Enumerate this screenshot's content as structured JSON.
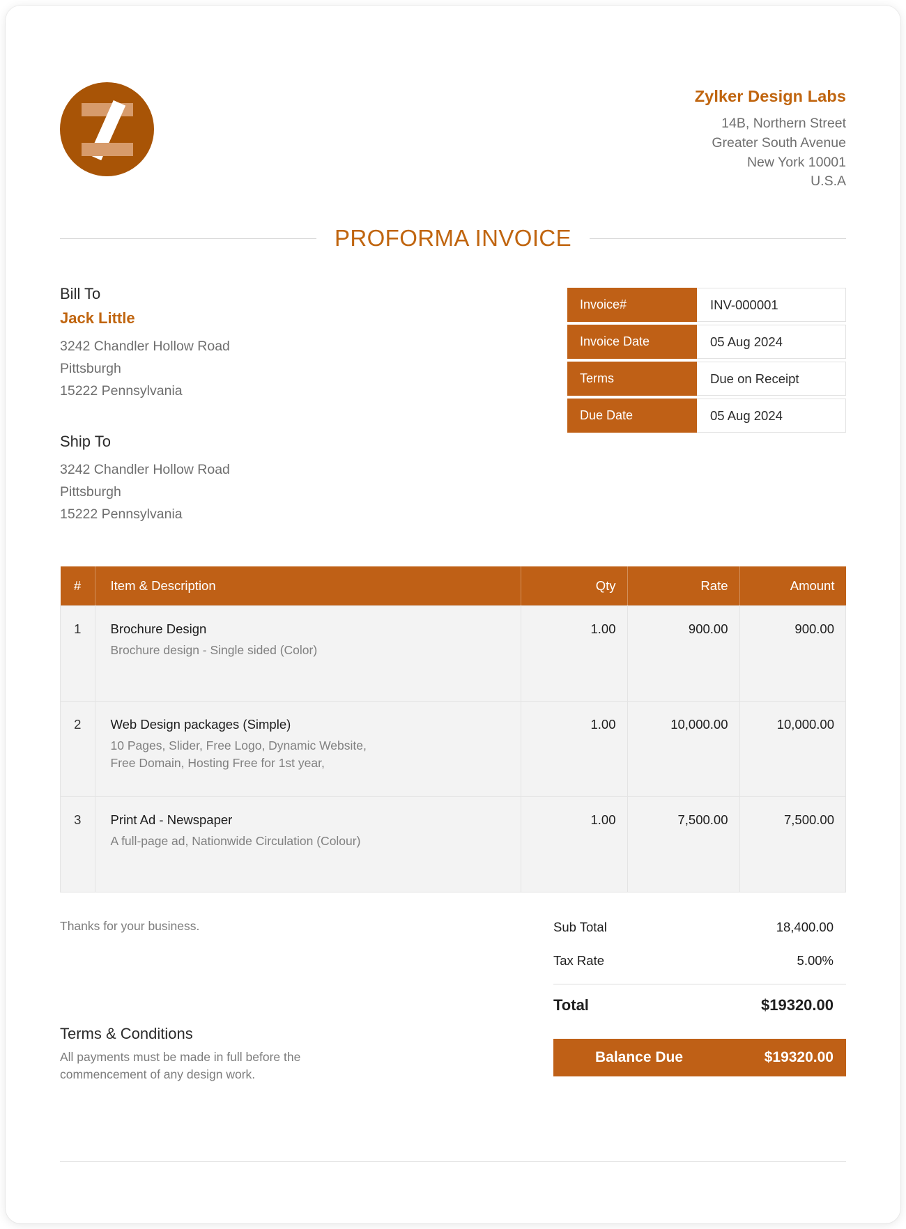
{
  "company": {
    "logo_letter": "Z",
    "name": "Zylker Design Labs",
    "address": [
      "14B, Northern Street",
      "Greater South Avenue",
      "New York 10001",
      "U.S.A"
    ]
  },
  "document": {
    "title": "PROFORMA INVOICE"
  },
  "bill_to": {
    "label": "Bill To",
    "name": "Jack Little",
    "address": [
      "3242 Chandler Hollow Road",
      "Pittsburgh",
      "15222 Pennsylvania"
    ]
  },
  "ship_to": {
    "label": "Ship To",
    "address": [
      "3242 Chandler Hollow Road",
      "Pittsburgh",
      "15222 Pennsylvania"
    ]
  },
  "details": [
    {
      "label": "Invoice#",
      "value": "INV-000001"
    },
    {
      "label": "Invoice Date",
      "value": "05 Aug 2024"
    },
    {
      "label": "Terms",
      "value": "Due on Receipt"
    },
    {
      "label": "Due Date",
      "value": "05 Aug 2024"
    }
  ],
  "items_table": {
    "columns": [
      "#",
      "Item & Description",
      "Qty",
      "Rate",
      "Amount"
    ],
    "rows": [
      {
        "no": "1",
        "name": "Brochure Design",
        "desc": [
          "Brochure design - Single sided (Color)"
        ],
        "qty": "1.00",
        "rate": "900.00",
        "amount": "900.00"
      },
      {
        "no": "2",
        "name": "Web Design packages (Simple)",
        "desc": [
          "10 Pages, Slider, Free Logo, Dynamic Website,",
          "Free Domain, Hosting Free for 1st year,"
        ],
        "qty": "1.00",
        "rate": "10,000.00",
        "amount": "10,000.00"
      },
      {
        "no": "3",
        "name": "Print Ad - Newspaper",
        "desc": [
          "A full-page ad, Nationwide Circulation (Colour)"
        ],
        "qty": "1.00",
        "rate": "7,500.00",
        "amount": "7,500.00"
      }
    ]
  },
  "thanks_note": "Thanks for your business.",
  "totals": {
    "sub_total_label": "Sub Total",
    "sub_total_value": "18,400.00",
    "tax_rate_label": "Tax Rate",
    "tax_rate_value": "5.00%",
    "total_label": "Total",
    "total_value": "$19320.00",
    "balance_due_label": "Balance Due",
    "balance_due_value": "$19320.00"
  },
  "terms": {
    "heading": "Terms & Conditions",
    "body": [
      "All payments must be made in full before the",
      "commencement of any design work."
    ]
  },
  "colors": {
    "accent": "#BF6016",
    "logo": "#A85406",
    "muted": "#6F6F6F",
    "row_bg": "#F3F3F3"
  }
}
